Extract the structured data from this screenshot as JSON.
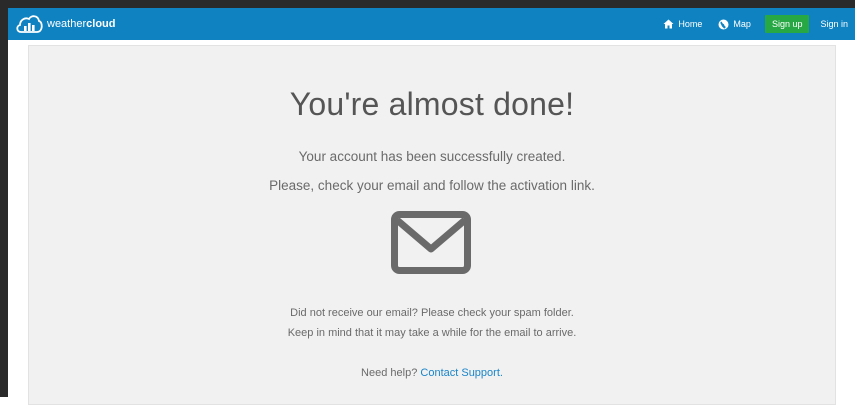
{
  "brand": {
    "name_light": "weather",
    "name_bold": "cloud"
  },
  "nav": {
    "home_label": "Home",
    "map_label": "Map",
    "signup_label": "Sign up",
    "signin_label": "Sign in"
  },
  "main": {
    "title": "You're almost done!",
    "line1": "Your account has been successfully created.",
    "line2": "Please, check your email and follow the activation link.",
    "line3": "Did not receive our email? Please check your spam folder.",
    "line4": "Keep in mind that it may take a while for the email to arrive.",
    "help_prefix": "Need help?",
    "help_link": "Contact Support."
  },
  "icons": {
    "logo": "weathercloud-logo-icon",
    "home": "home-icon",
    "map": "globe-icon",
    "mail": "envelope-icon"
  },
  "colors": {
    "navbar": "#0f83c2",
    "signup": "#27a844",
    "link": "#1a85c9",
    "panel": "#f1f1f1"
  }
}
